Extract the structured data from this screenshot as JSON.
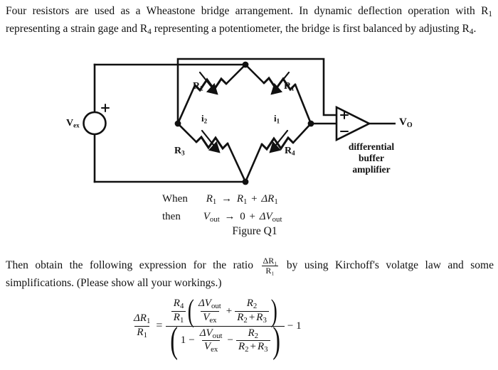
{
  "document": {
    "intro_paragraph": "Four resistors are used as a Wheastone bridge arrangement. In dynamic deflection operation with R₁ representing a strain gage and R₄ representing a potentiometer, the bridge is first balanced by adjusting R₄.",
    "second_paragraph": "Then obtain the following expression for the ratio ΔR₁/R₁ by using Kirchoff's volatge law and some simplifications. (Please show all your workings.)"
  },
  "intro": {
    "line1": "Four resistors are used as a Wheastone bridge arrangement. In dynamic deflection operation",
    "line2_a": "with R",
    "line2_sub1": "1",
    "line2_b": " representing a strain gage and R",
    "line2_sub2": "4",
    "line2_c": " representing a potentiometer, the bridge is first",
    "line3_a": "balanced by adjusting R",
    "line3_sub": "4",
    "line3_b": "."
  },
  "figure": {
    "caption": "Figure Q1",
    "source_label": "Vex",
    "source_label_base": "V",
    "source_label_sub": "ex",
    "source_plus": "+",
    "output_label": "Vo",
    "output_label_base": "V",
    "output_label_sub": "O",
    "amp_plus": "+",
    "amp_minus": "−",
    "amp_caption_line1": "differential",
    "amp_caption_line2": "buffer",
    "amp_caption_line3": "amplifier",
    "resistors": [
      {
        "name": "R2",
        "base": "R",
        "sub": "2"
      },
      {
        "name": "R1",
        "base": "R",
        "sub": "1"
      },
      {
        "name": "R3",
        "base": "R",
        "sub": "3"
      },
      {
        "name": "R4",
        "base": "R",
        "sub": "4"
      }
    ],
    "currents": [
      {
        "name": "i2",
        "base": "i",
        "sub": "2"
      },
      {
        "name": "i1",
        "base": "i",
        "sub": "1"
      }
    ]
  },
  "conditions": {
    "when_keyword": "When",
    "when_expr_r": "R",
    "when_expr_r_sub": "1",
    "when_arrow": "→",
    "when_expr_rhs_r": "R",
    "when_expr_rhs_sub": "1",
    "when_plus": "+",
    "when_delta_r": "ΔR",
    "when_delta_r_sub": "1",
    "then_keyword": "then",
    "then_v": "V",
    "then_v_sub": "out",
    "then_arrow": "→",
    "then_zero": "0",
    "then_plus": "+",
    "then_delta_v": "ΔV",
    "then_delta_v_sub": "out"
  },
  "second_paragraph": {
    "part1": "Then obtain the following expression for the ratio",
    "ratio_num": "ΔR₁",
    "ratio_den": "R₁",
    "part2": "by using Kirchoff's volatge law and some",
    "line2": "simplifications. (Please show all your workings.)"
  },
  "equation": {
    "lhs_num": "ΔR₁",
    "lhs_num_base": "ΔR",
    "lhs_num_sub": "1",
    "lhs_den_base": "R",
    "lhs_den_sub": "1",
    "equals": "=",
    "coef_num_base": "R",
    "coef_num_sub": "4",
    "coef_den_base": "R",
    "coef_den_sub": "1",
    "open_paren": "(",
    "close_paren": ")",
    "dv_num_base": "ΔV",
    "dv_num_sub": "out",
    "dv_den_base": "V",
    "dv_den_sub": "ex",
    "plus": "+",
    "minus": "−",
    "r2_base": "R",
    "r2_sub": "2",
    "r2r3_a": "R",
    "r2r3_a_sub": "2",
    "r2r3_plus": "+",
    "r2r3_b": "R",
    "r2r3_b_sub": "3",
    "one": "1",
    "minus_one": "− 1"
  },
  "colors": {
    "ink": "#111111",
    "page": "#ffffff"
  }
}
